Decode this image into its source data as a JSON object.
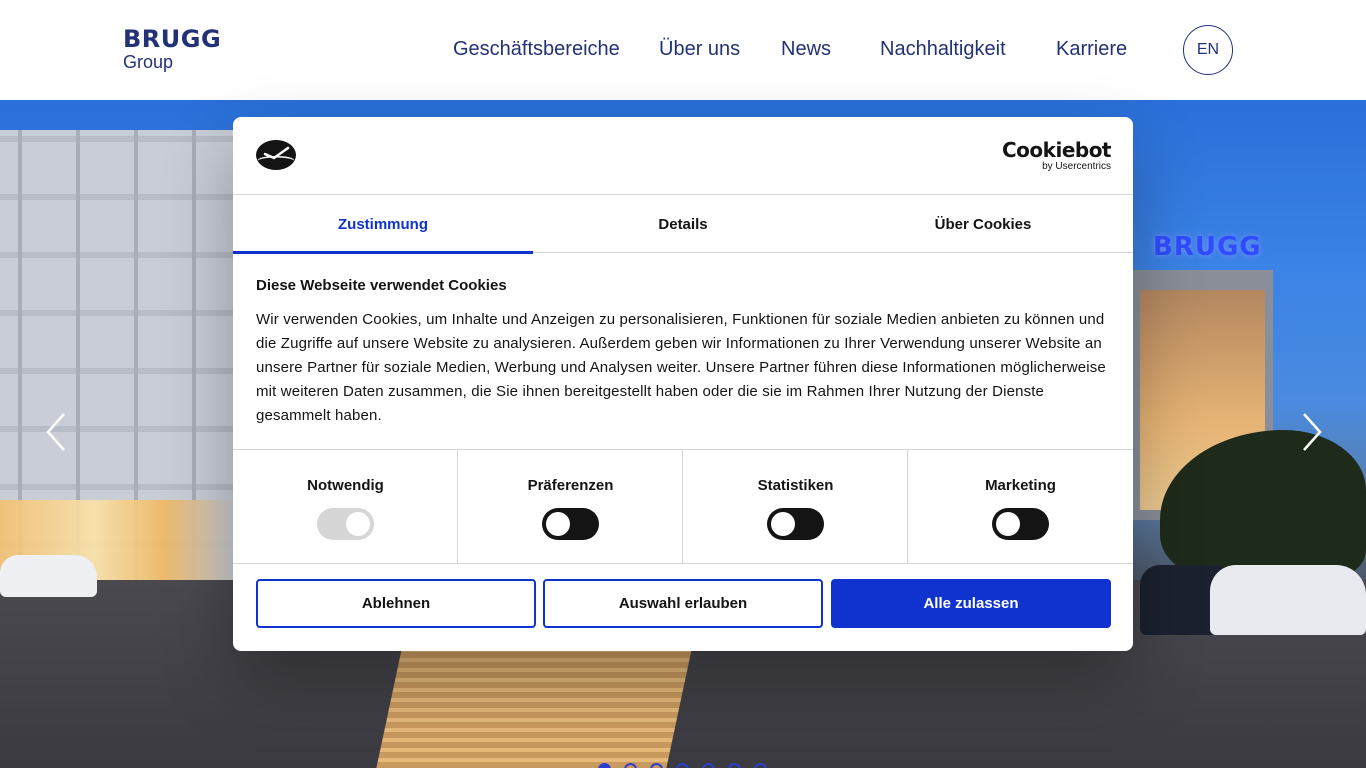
{
  "header": {
    "logo_main": "BRUGG",
    "logo_sub": "Group",
    "nav": [
      "Geschäftsbereiche",
      "Über uns",
      "News",
      "Nachhaltigkeit",
      "Karriere"
    ],
    "lang": "EN"
  },
  "hero": {
    "sign_text": "BRUGG",
    "slides_count": 7,
    "active_slide": 1
  },
  "cookie": {
    "brand_name": "Cookiebot",
    "brand_by": "by Usercentrics",
    "tabs": [
      "Zustimmung",
      "Details",
      "Über Cookies"
    ],
    "active_tab": "Zustimmung",
    "title": "Diese Webseite verwendet Cookies",
    "text": "Wir verwenden Cookies, um Inhalte und Anzeigen zu personalisieren, Funktionen für soziale Medien anbieten zu können und die Zugriffe auf unsere Website zu analysieren. Außerdem geben wir Informationen zu Ihrer Verwendung unserer Website an unsere Partner für soziale Medien, Werbung und Analysen weiter. Unsere Partner führen diese Informationen möglicherweise mit weiteren Daten zusammen, die Sie ihnen bereitgestellt haben oder die sie im Rahmen Ihrer Nutzung der Dienste gesammelt haben.",
    "categories": [
      {
        "label": "Notwendig",
        "checked": true,
        "disabled": true
      },
      {
        "label": "Präferenzen",
        "checked": false,
        "disabled": false
      },
      {
        "label": "Statistiken",
        "checked": false,
        "disabled": false
      },
      {
        "label": "Marketing",
        "checked": false,
        "disabled": false
      }
    ],
    "buttons": {
      "deny": "Ablehnen",
      "allow_selection": "Auswahl erlauben",
      "allow_all": "Alle zulassen"
    }
  },
  "colors": {
    "brand_navy": "#233177",
    "cookie_accent": "#1032cf"
  }
}
